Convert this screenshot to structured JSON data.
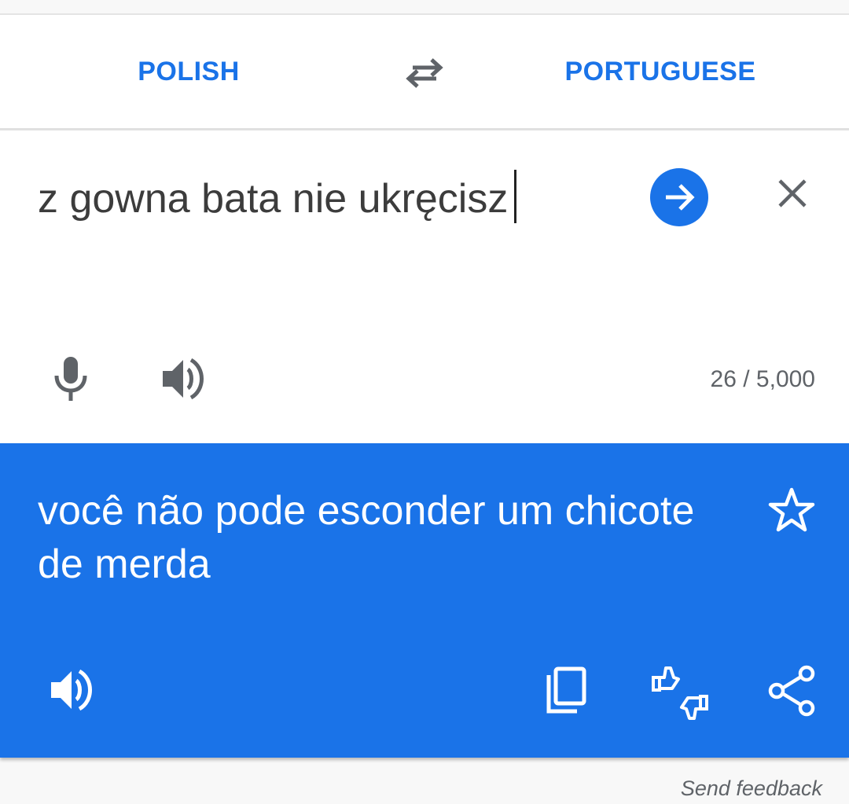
{
  "languages": {
    "source": "POLISH",
    "target": "PORTUGUESE",
    "swap_icon": "swap-arrows-icon"
  },
  "input": {
    "text": "z gowna bata nie ukręcisz",
    "char_count": "26 / 5,000",
    "icons": [
      "arrow-right-icon",
      "close-icon",
      "microphone-icon",
      "speaker-icon"
    ]
  },
  "output": {
    "text": "você não pode esconder um chicote de merda",
    "icons": [
      "star-icon",
      "speaker-icon",
      "copy-icon",
      "thumbs-rating-icon",
      "share-icon"
    ]
  },
  "footer": {
    "feedback_label": "Send feedback"
  },
  "colors": {
    "accent": "#1a73e8",
    "icon_gray": "#5f6368",
    "text_dark": "#3c3c3c"
  }
}
